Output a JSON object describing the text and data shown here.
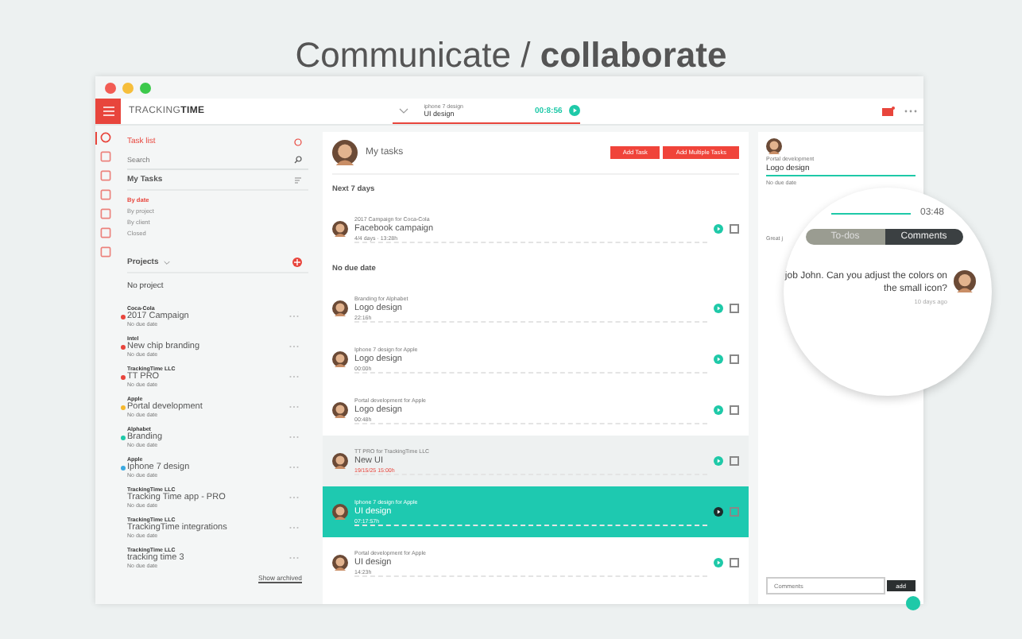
{
  "headline": "Communicate / **collaborate**",
  "app": {
    "logo_light": "TRACKING",
    "logo_bold": "TIME"
  },
  "rail": [
    {
      "selected": true
    },
    {
      "selected": false
    },
    {
      "selected": false
    },
    {
      "selected": false
    },
    {
      "selected": false
    },
    {
      "selected": false
    },
    {
      "selected": false
    }
  ],
  "timer": {
    "project": "iphone 7 design",
    "task": "UI design",
    "time": "00:8:56"
  },
  "sidebar": {
    "title": "Task list",
    "search_placeholder": "Search",
    "my_tasks": "My Tasks",
    "filters": [
      {
        "label": "By date",
        "selected": true
      },
      {
        "label": "By project",
        "selected": false
      },
      {
        "label": "By client",
        "selected": false
      },
      {
        "label": "Closed",
        "selected": false
      }
    ],
    "projects_title": "Projects",
    "no_project": "No project",
    "projects": [
      {
        "client": "Coca-Cola",
        "name": "2017 Campaign",
        "due": "No due date",
        "color": "#e8453c"
      },
      {
        "client": "Intel",
        "name": "New chip branding",
        "due": "No due date",
        "color": "#e8453c"
      },
      {
        "client": "TrackingTime LLC",
        "name": "TT PRO",
        "due": "No due date",
        "color": "#e8453c"
      },
      {
        "client": "Apple",
        "name": "Portal development",
        "due": "No due date",
        "color": "#f5b82e"
      },
      {
        "client": "Alphabet",
        "name": "Branding",
        "due": "No due date",
        "color": "#1ec9a8"
      },
      {
        "client": "Apple",
        "name": "Iphone 7 design",
        "due": "No due date",
        "color": "#3aa8e0"
      },
      {
        "client": "TrackingTime LLC",
        "name": "Tracking Time app - PRO",
        "due": "No due date"
      },
      {
        "client": "TrackingTime LLC",
        "name": "TrackingTime integrations",
        "due": "No due date"
      },
      {
        "client": "TrackingTime LLC",
        "name": "tracking time 3",
        "due": "No due date"
      }
    ],
    "show_archived": "Show archived"
  },
  "main": {
    "title": "My tasks",
    "buttons": [
      "Add Task",
      "Add Multiple Tasks"
    ],
    "groups": [
      {
        "heading": "Next 7 days",
        "tasks": [
          {
            "project": "2017 Campaign for Coca-Cola",
            "name": "Facebook campaign",
            "time": "4/4 days · 13:28h",
            "selected": false,
            "overdue": false,
            "hovered": false
          }
        ]
      },
      {
        "heading": "No due date",
        "tasks": [
          {
            "project": "Branding for Alphabet",
            "name": "Logo design",
            "time": "22:16h",
            "selected": false,
            "overdue": false,
            "hovered": false
          },
          {
            "project": "Iphone 7 design for Apple",
            "name": "Logo design",
            "time": "00:00h",
            "selected": false,
            "overdue": false,
            "hovered": false
          },
          {
            "project": "Portal development for Apple",
            "name": "Logo design",
            "time": "00:48h",
            "selected": false,
            "overdue": false,
            "hovered": false
          },
          {
            "project": "TT PRO for TrackingTime LLC",
            "name": "New UI",
            "time": "19/15/25 15:00h",
            "selected": false,
            "overdue": true,
            "hovered": true
          },
          {
            "project": "Iphone 7 design for Apple",
            "name": "UI design",
            "time": "07:17:57h",
            "selected": true,
            "overdue": false,
            "hovered": false
          },
          {
            "project": "Portal development for Apple",
            "name": "UI design",
            "time": "14:23h",
            "selected": false,
            "overdue": false,
            "hovered": false
          }
        ]
      }
    ]
  },
  "detail": {
    "project": "Portal development",
    "task": "Logo design",
    "due": "No due date",
    "comment_cut": "Great j",
    "comment_placeholder": "Comments",
    "add_button": "add"
  },
  "magnifier": {
    "time": "03:48",
    "tabs": [
      {
        "label": "To-dos",
        "selected": false
      },
      {
        "label": "Comments",
        "selected": true
      }
    ],
    "comment": "job John. Can you adjust the colors on the small icon?",
    "comment_time": "10 days ago"
  }
}
